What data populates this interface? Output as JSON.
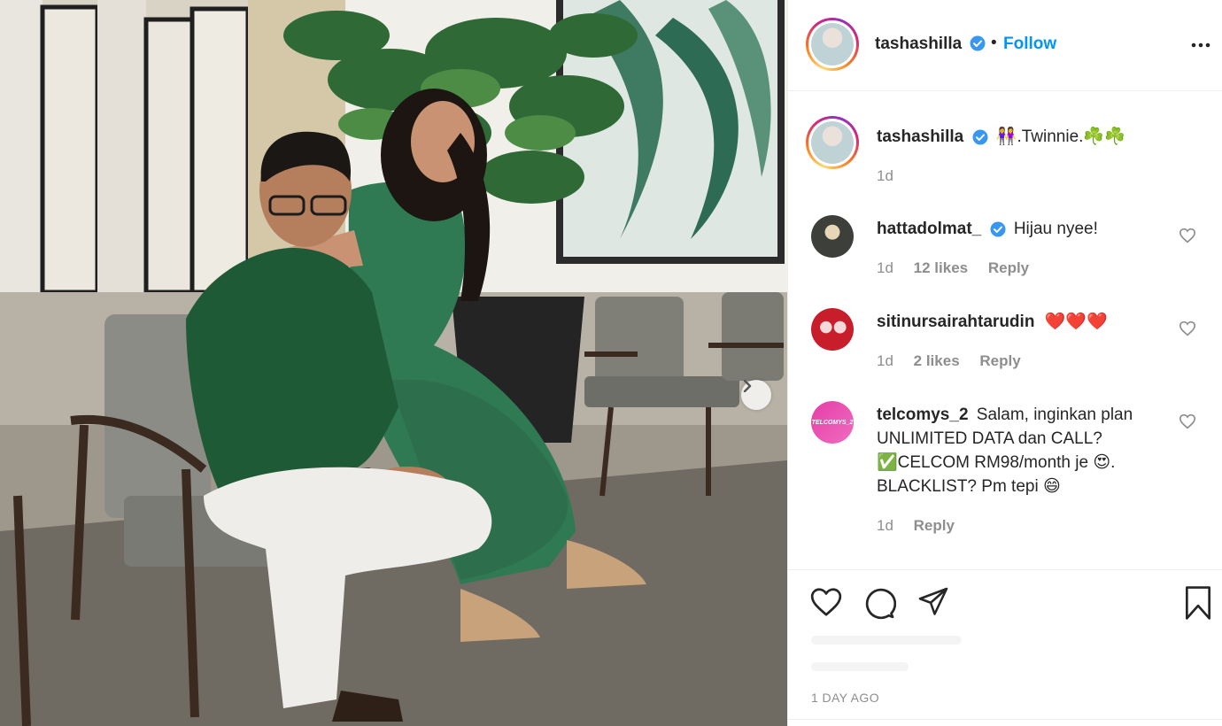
{
  "post": {
    "username": "tashashilla",
    "follow_label": "Follow",
    "dot": "•"
  },
  "caption": {
    "username": "tashashilla",
    "text": "👭.Twinnie.☘️☘️",
    "time": "1d"
  },
  "comments": [
    {
      "username": "hattadolmat_",
      "verified": true,
      "text": "Hijau nyee!",
      "time": "1d",
      "likes": "12 likes",
      "reply": "Reply"
    },
    {
      "username": "sitinursairahtarudin",
      "verified": false,
      "text": "❤️❤️❤️",
      "time": "1d",
      "likes": "2 likes",
      "reply": "Reply"
    },
    {
      "username": "telcomys_2",
      "verified": false,
      "text": "Salam, inginkan plan UNLIMITED DATA dan CALL? ✅CELCOM RM98/month je 😍. BLACKLIST? Pm tepi 😄",
      "time": "1d",
      "likes": "",
      "reply": "Reply",
      "avatar_text": "TELCOMYS_2"
    }
  ],
  "footer": {
    "date": "1 DAY AGO"
  },
  "icons": {
    "verified": "verified-badge-icon",
    "more": "more-options-icon",
    "like": "heart-icon",
    "comment": "comment-icon",
    "share": "share-icon",
    "save": "bookmark-icon",
    "next": "chevron-right-icon"
  },
  "colors": {
    "accent": "#0095f6",
    "text": "#262626",
    "muted": "#8e8e8e"
  }
}
